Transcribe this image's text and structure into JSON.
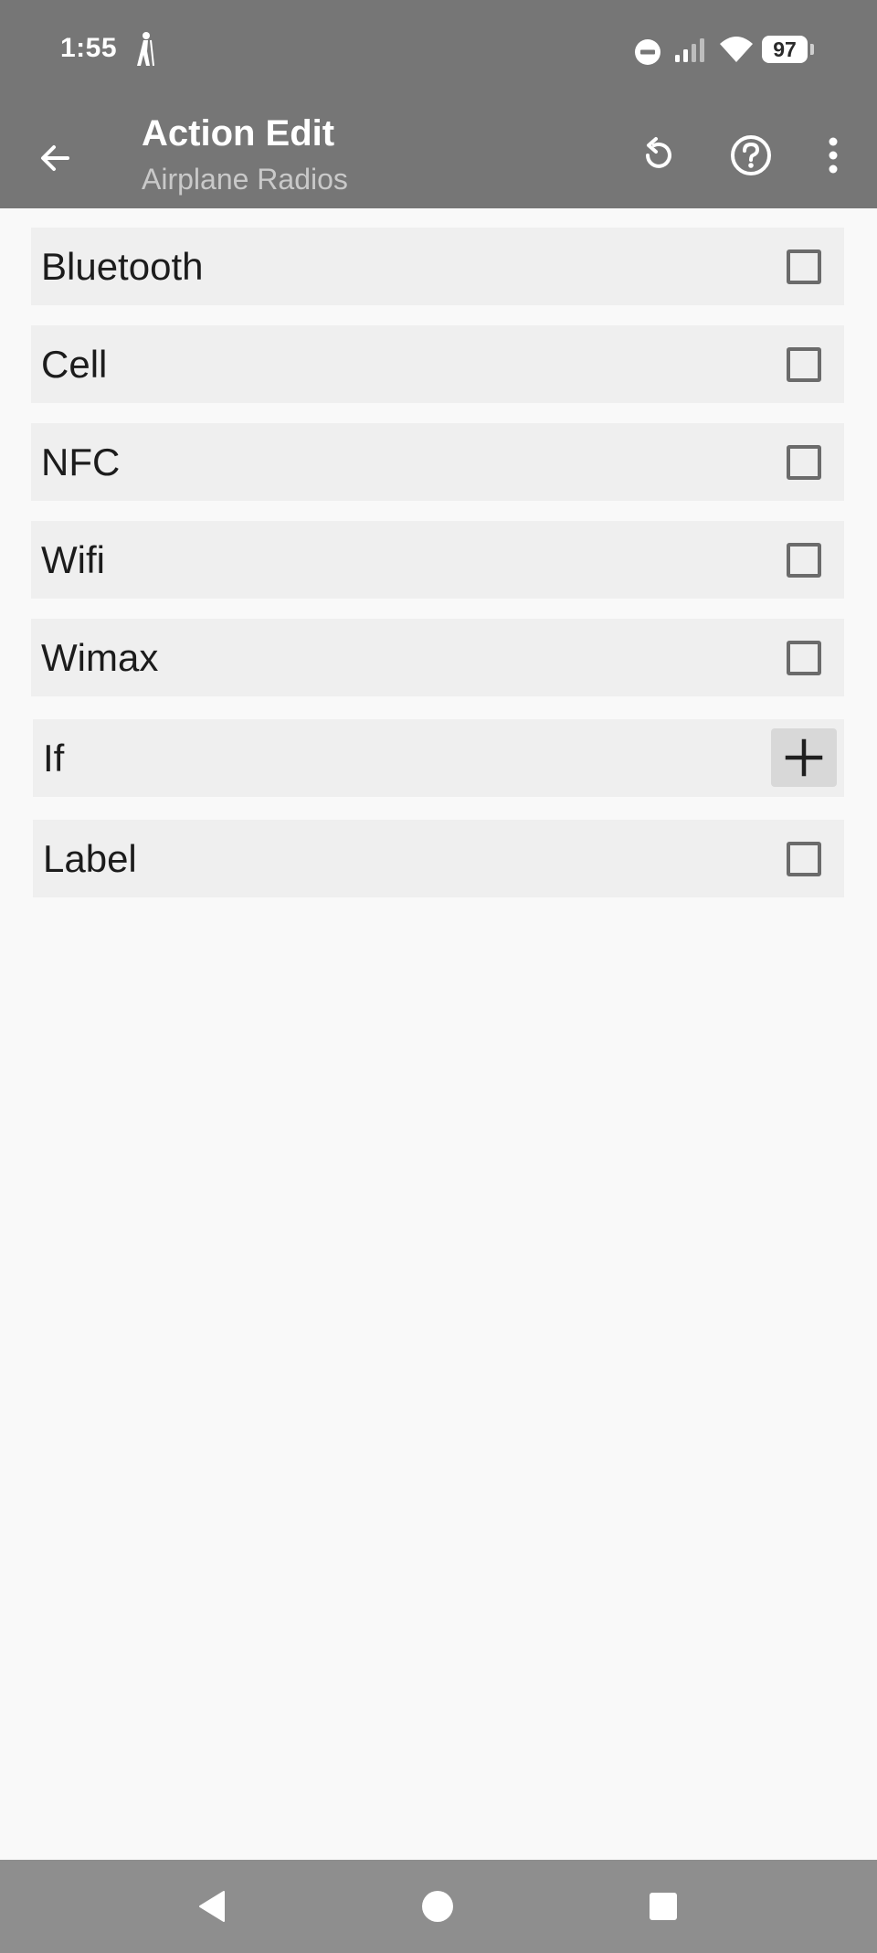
{
  "status_bar": {
    "time": "1:55",
    "battery": "97",
    "icons": [
      "hiker-icon",
      "do-not-disturb-icon",
      "signal-icon",
      "wifi-icon",
      "battery-icon"
    ]
  },
  "app_bar": {
    "title": "Action Edit",
    "subtitle": "Airplane Radios",
    "actions": [
      "back-arrow-icon",
      "reset-icon",
      "help-icon",
      "more-vert-icon"
    ]
  },
  "options": [
    {
      "label": "Bluetooth",
      "control": "checkbox",
      "checked": false
    },
    {
      "label": "Cell",
      "control": "checkbox",
      "checked": false
    },
    {
      "label": "NFC",
      "control": "checkbox",
      "checked": false
    },
    {
      "label": "Wifi",
      "control": "checkbox",
      "checked": false
    },
    {
      "label": "Wimax",
      "control": "checkbox",
      "checked": false
    },
    {
      "label": "If",
      "control": "plus-button"
    },
    {
      "label": "Label",
      "control": "checkbox",
      "checked": false
    }
  ],
  "nav_bar": {
    "icons": [
      "nav-back-icon",
      "nav-home-icon",
      "nav-recents-icon"
    ]
  },
  "colors": {
    "bar": "#767676",
    "navbar": "#8e8e8e",
    "row_bg": "#efefef",
    "page_bg": "#f9f9f9",
    "subtitle": "#c9c9c9"
  }
}
